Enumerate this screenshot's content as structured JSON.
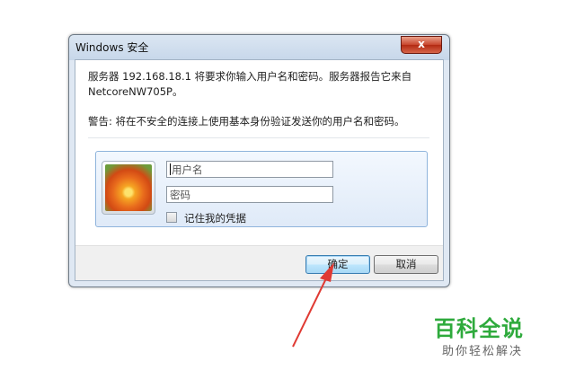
{
  "dialog": {
    "title": "Windows 安全",
    "close_label": "x",
    "message_line1": "服务器 192.168.18.1 将要求你输入用户名和密码。服务器报告它来自",
    "message_line2": "NetcoreNW705P。",
    "warning": "警告: 将在不安全的连接上使用基本身份验证发送你的用户名和密码。",
    "username_placeholder": "用户名",
    "password_placeholder": "密码",
    "remember_label": "记住我的凭据",
    "ok_label": "确定",
    "cancel_label": "取消"
  },
  "watermark": {
    "title": "百科全说",
    "subtitle": "助你轻松解决"
  },
  "colors": {
    "arrow": "#e03a33",
    "watermark_green": "#2eaa3c"
  }
}
